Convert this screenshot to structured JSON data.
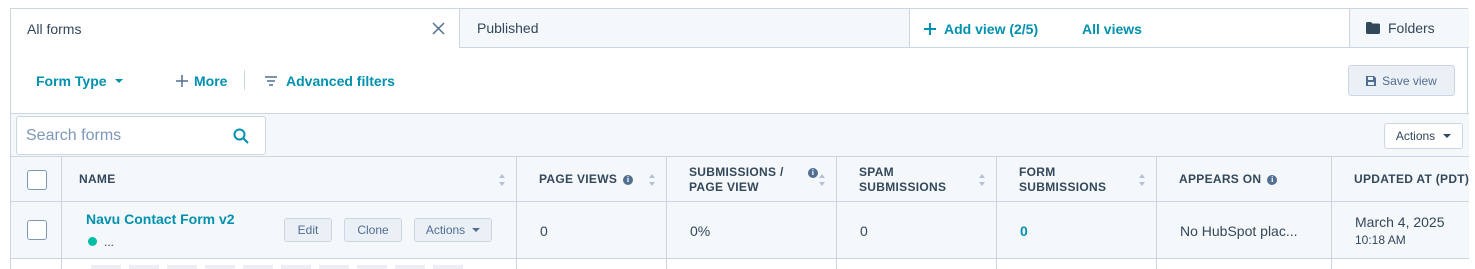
{
  "tabs": {
    "active_label": "All forms",
    "inactive_label": "Published",
    "add_view_label": "Add view (2/5)",
    "all_views_label": "All views",
    "folders_label": "Folders"
  },
  "filters": {
    "form_type_label": "Form Type",
    "more_label": "More",
    "advanced_filters_label": "Advanced filters",
    "save_view_label": "Save view"
  },
  "search": {
    "placeholder": "Search forms",
    "actions_label": "Actions"
  },
  "table": {
    "columns": [
      {
        "label": "NAME"
      },
      {
        "label": "PAGE VIEWS"
      },
      {
        "label": "SUBMISSIONS / PAGE VIEW"
      },
      {
        "label": "SPAM SUBMISSIONS"
      },
      {
        "label": "FORM SUBMISSIONS"
      },
      {
        "label": "APPEARS ON"
      },
      {
        "label": "UPDATED AT (PDT)"
      }
    ],
    "rows": [
      {
        "name": "Navu Contact Form v2",
        "status": "...",
        "edit_label": "Edit",
        "clone_label": "Clone",
        "actions_label": "Actions",
        "page_views": "0",
        "submissions_per_view": "0%",
        "spam_submissions": "0",
        "form_submissions": "0",
        "appears_on": "No HubSpot plac...",
        "updated_date": "March 4, 2025",
        "updated_time": "10:18 AM"
      }
    ]
  },
  "colors": {
    "link": "#0091ae",
    "text": "#33475b",
    "border": "#cbd6e2",
    "header_bg": "#f5f8fa",
    "status_dot": "#00bda5"
  }
}
